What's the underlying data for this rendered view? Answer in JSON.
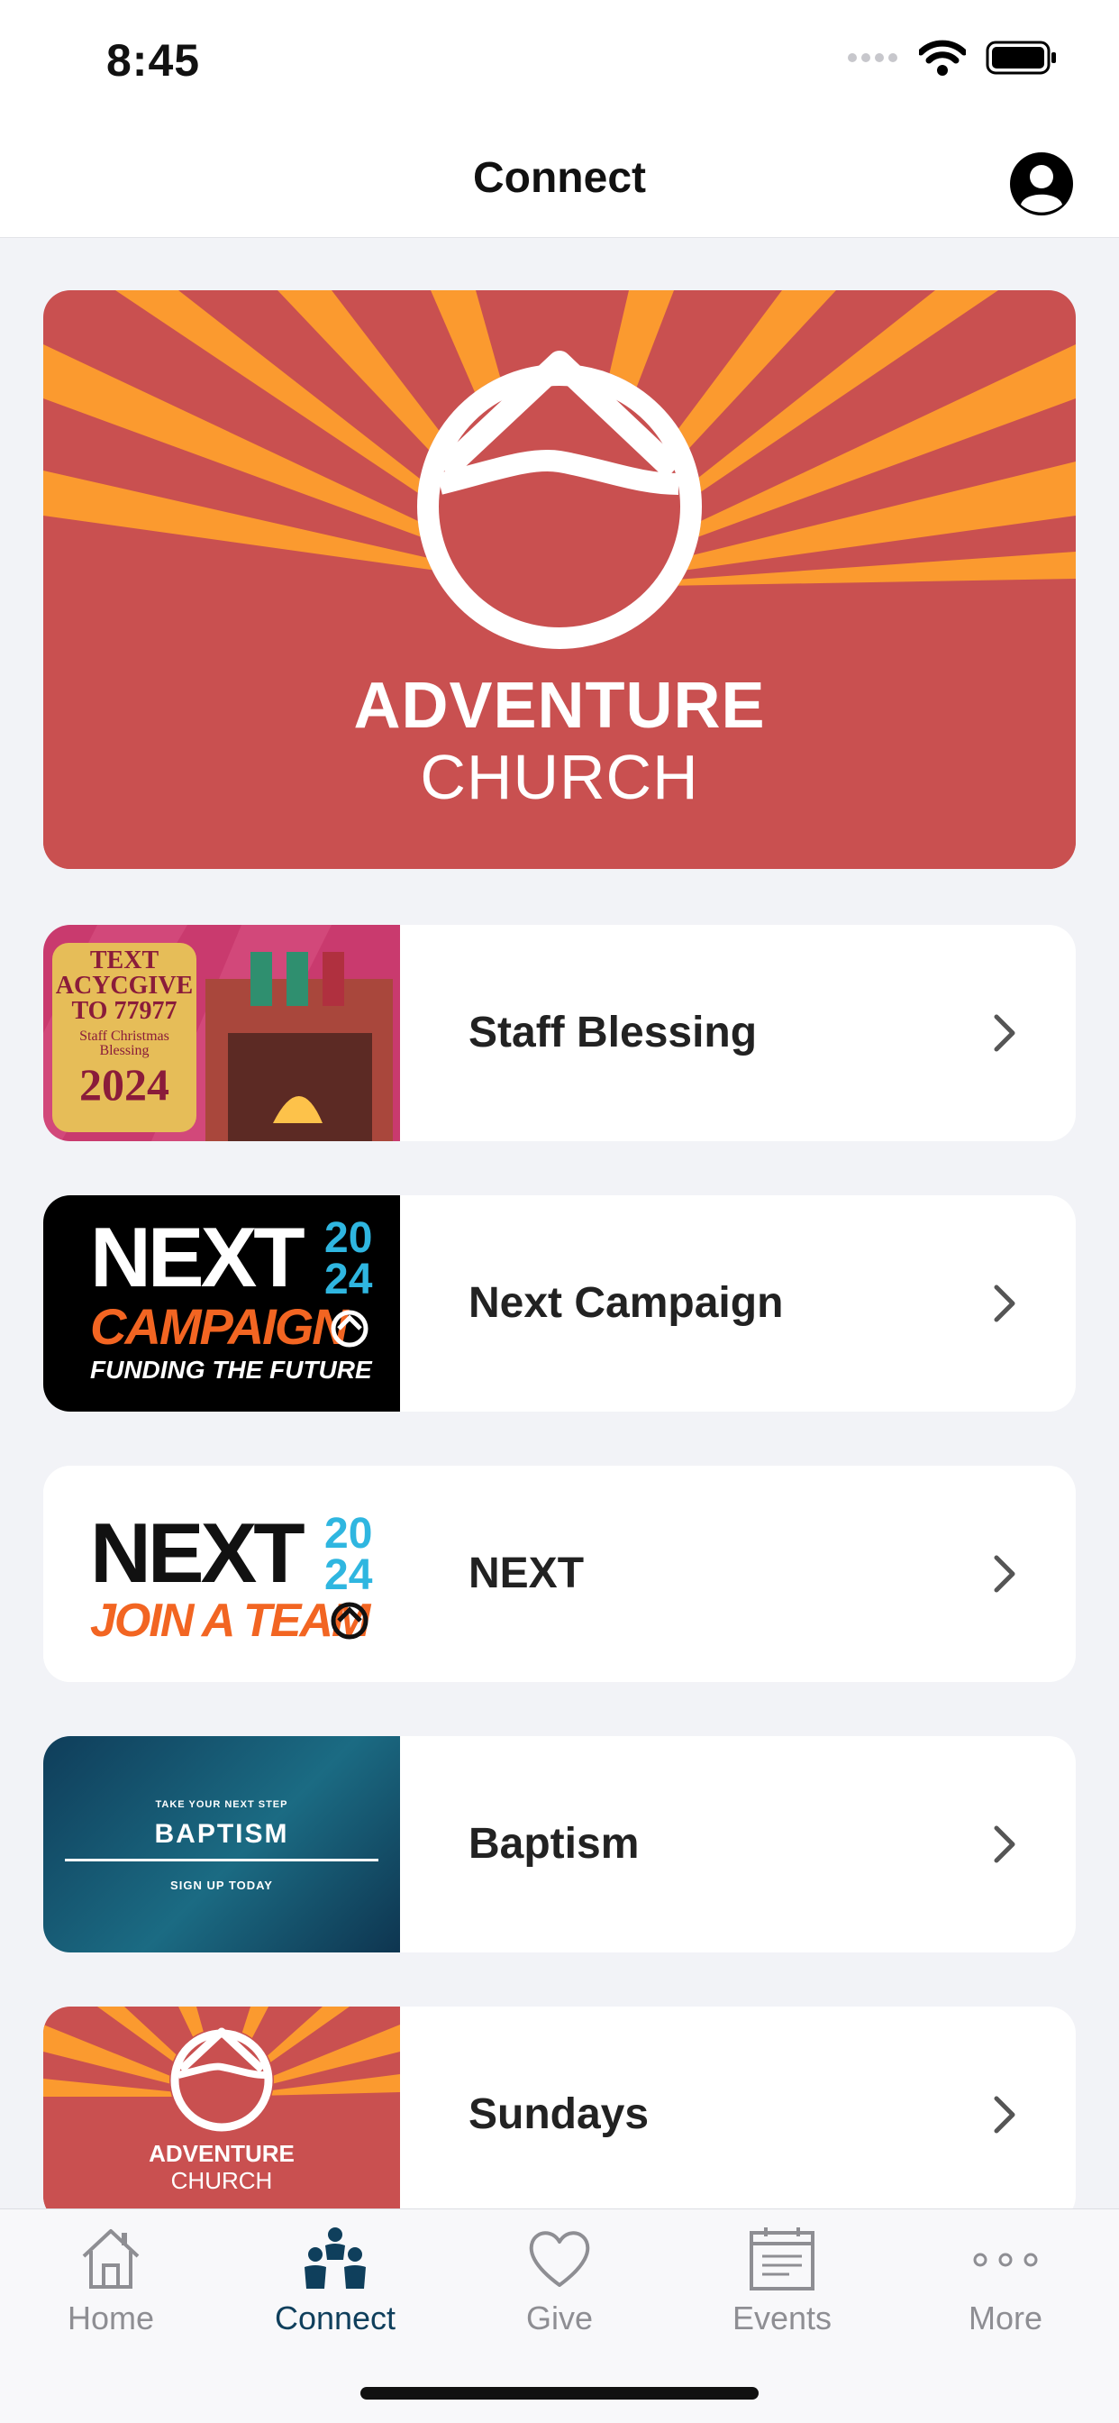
{
  "status": {
    "time": "8:45"
  },
  "header": {
    "title": "Connect"
  },
  "hero": {
    "line1": "ADVENTURE",
    "line2": "CHURCH"
  },
  "items": [
    {
      "label": "Staff Blessing",
      "thumb": {
        "lines": [
          "TEXT",
          "ACYCGIVE",
          "TO 77977",
          "Staff Christmas",
          "Blessing",
          "2024"
        ]
      }
    },
    {
      "label": "Next Campaign",
      "thumb": {
        "title": "NEXT",
        "year_top": "20",
        "year_bottom": "24",
        "sub": "CAMPAIGN",
        "tag": "FUNDING THE FUTURE"
      }
    },
    {
      "label": "NEXT",
      "thumb": {
        "title": "NEXT",
        "year_top": "20",
        "year_bottom": "24",
        "sub": "JOIN A TEAM"
      }
    },
    {
      "label": "Baptism",
      "thumb": {
        "kicker": "TAKE YOUR NEXT STEP",
        "title": "BAPTISM",
        "sub": "SIGN UP TODAY"
      }
    },
    {
      "label": "Sundays",
      "thumb": {
        "line1": "ADVENTURE",
        "line2": "CHURCH"
      }
    }
  ],
  "tabs": [
    {
      "label": "Home",
      "icon": "house-icon"
    },
    {
      "label": "Connect",
      "icon": "people-icon",
      "active": true
    },
    {
      "label": "Give",
      "icon": "heart-icon"
    },
    {
      "label": "Events",
      "icon": "calendar-icon"
    },
    {
      "label": "More",
      "icon": "more-dots-icon"
    }
  ],
  "colors": {
    "brand_red": "#c95050",
    "brand_orange": "#fb9a2f",
    "active_tab": "#0f3f5c",
    "inactive_tab": "#8e8e93",
    "background": "#f2f3f7"
  }
}
